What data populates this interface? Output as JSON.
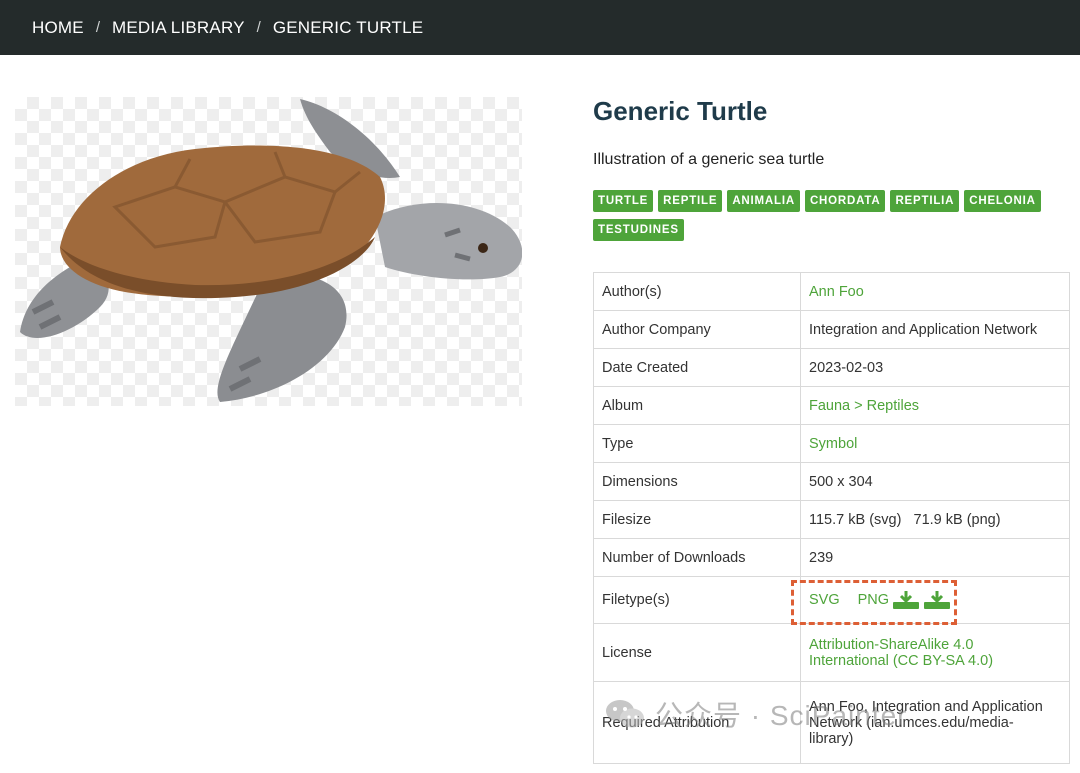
{
  "breadcrumb": {
    "items": [
      "HOME",
      "MEDIA LIBRARY",
      "GENERIC TURTLE"
    ],
    "separator": "/"
  },
  "media": {
    "title": "Generic Turtle",
    "description": "Illustration of a generic sea turtle",
    "image_icon": "sea-turtle-illustration",
    "tags": [
      "TURTLE",
      "REPTILE",
      "ANIMALIA",
      "CHORDATA",
      "REPTILIA",
      "CHELONIA",
      "TESTUDINES"
    ]
  },
  "details": {
    "author_label": "Author(s)",
    "author_value": "Ann Foo",
    "company_label": "Author Company",
    "company_value": "Integration and Application Network",
    "date_label": "Date Created",
    "date_value": "2023-02-03",
    "album_label": "Album",
    "album_value": "Fauna > Reptiles",
    "type_label": "Type",
    "type_value": "Symbol",
    "dimensions_label": "Dimensions",
    "dimensions_value": "500 x 304",
    "filesize_label": "Filesize",
    "filesize_svg": "115.7 kB (svg)",
    "filesize_png": "71.9 kB (png)",
    "downloads_label": "Number of Downloads",
    "downloads_value": "239",
    "filetypes_label": "Filetype(s)",
    "filetype_svg": "SVG",
    "filetype_png": "PNG",
    "license_label": "License",
    "license_value_line1": "Attribution-ShareAlike 4.0",
    "license_value_line2": "International (CC BY-SA 4.0)",
    "attribution_label": "Required Attribution",
    "attribution_value_line1": "Ann Foo, Integration and Application",
    "attribution_value_line2": "Network (ian.umces.edu/media-",
    "attribution_value_line3": "library)"
  },
  "watermark": {
    "text": "公众号 · SciPainter",
    "icon": "wechat-icon"
  },
  "colors": {
    "topbar": "#242b2b",
    "accent_green": "#4ea43a",
    "title": "#1f3b4a",
    "highlight": "#dd5f35"
  }
}
